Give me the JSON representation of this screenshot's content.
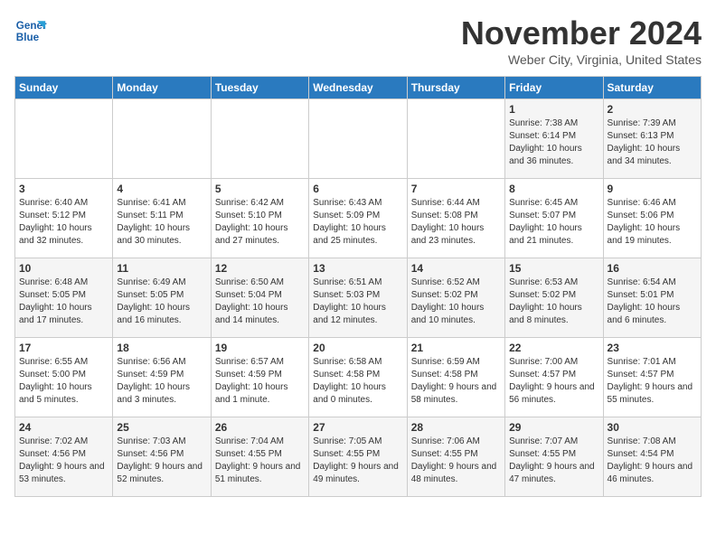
{
  "logo": {
    "line1": "General",
    "line2": "Blue"
  },
  "title": "November 2024",
  "subtitle": "Weber City, Virginia, United States",
  "days_of_week": [
    "Sunday",
    "Monday",
    "Tuesday",
    "Wednesday",
    "Thursday",
    "Friday",
    "Saturday"
  ],
  "weeks": [
    [
      {
        "day": "",
        "info": ""
      },
      {
        "day": "",
        "info": ""
      },
      {
        "day": "",
        "info": ""
      },
      {
        "day": "",
        "info": ""
      },
      {
        "day": "",
        "info": ""
      },
      {
        "day": "1",
        "info": "Sunrise: 7:38 AM\nSunset: 6:14 PM\nDaylight: 10 hours and 36 minutes."
      },
      {
        "day": "2",
        "info": "Sunrise: 7:39 AM\nSunset: 6:13 PM\nDaylight: 10 hours and 34 minutes."
      }
    ],
    [
      {
        "day": "3",
        "info": "Sunrise: 6:40 AM\nSunset: 5:12 PM\nDaylight: 10 hours and 32 minutes."
      },
      {
        "day": "4",
        "info": "Sunrise: 6:41 AM\nSunset: 5:11 PM\nDaylight: 10 hours and 30 minutes."
      },
      {
        "day": "5",
        "info": "Sunrise: 6:42 AM\nSunset: 5:10 PM\nDaylight: 10 hours and 27 minutes."
      },
      {
        "day": "6",
        "info": "Sunrise: 6:43 AM\nSunset: 5:09 PM\nDaylight: 10 hours and 25 minutes."
      },
      {
        "day": "7",
        "info": "Sunrise: 6:44 AM\nSunset: 5:08 PM\nDaylight: 10 hours and 23 minutes."
      },
      {
        "day": "8",
        "info": "Sunrise: 6:45 AM\nSunset: 5:07 PM\nDaylight: 10 hours and 21 minutes."
      },
      {
        "day": "9",
        "info": "Sunrise: 6:46 AM\nSunset: 5:06 PM\nDaylight: 10 hours and 19 minutes."
      }
    ],
    [
      {
        "day": "10",
        "info": "Sunrise: 6:48 AM\nSunset: 5:05 PM\nDaylight: 10 hours and 17 minutes."
      },
      {
        "day": "11",
        "info": "Sunrise: 6:49 AM\nSunset: 5:05 PM\nDaylight: 10 hours and 16 minutes."
      },
      {
        "day": "12",
        "info": "Sunrise: 6:50 AM\nSunset: 5:04 PM\nDaylight: 10 hours and 14 minutes."
      },
      {
        "day": "13",
        "info": "Sunrise: 6:51 AM\nSunset: 5:03 PM\nDaylight: 10 hours and 12 minutes."
      },
      {
        "day": "14",
        "info": "Sunrise: 6:52 AM\nSunset: 5:02 PM\nDaylight: 10 hours and 10 minutes."
      },
      {
        "day": "15",
        "info": "Sunrise: 6:53 AM\nSunset: 5:02 PM\nDaylight: 10 hours and 8 minutes."
      },
      {
        "day": "16",
        "info": "Sunrise: 6:54 AM\nSunset: 5:01 PM\nDaylight: 10 hours and 6 minutes."
      }
    ],
    [
      {
        "day": "17",
        "info": "Sunrise: 6:55 AM\nSunset: 5:00 PM\nDaylight: 10 hours and 5 minutes."
      },
      {
        "day": "18",
        "info": "Sunrise: 6:56 AM\nSunset: 4:59 PM\nDaylight: 10 hours and 3 minutes."
      },
      {
        "day": "19",
        "info": "Sunrise: 6:57 AM\nSunset: 4:59 PM\nDaylight: 10 hours and 1 minute."
      },
      {
        "day": "20",
        "info": "Sunrise: 6:58 AM\nSunset: 4:58 PM\nDaylight: 10 hours and 0 minutes."
      },
      {
        "day": "21",
        "info": "Sunrise: 6:59 AM\nSunset: 4:58 PM\nDaylight: 9 hours and 58 minutes."
      },
      {
        "day": "22",
        "info": "Sunrise: 7:00 AM\nSunset: 4:57 PM\nDaylight: 9 hours and 56 minutes."
      },
      {
        "day": "23",
        "info": "Sunrise: 7:01 AM\nSunset: 4:57 PM\nDaylight: 9 hours and 55 minutes."
      }
    ],
    [
      {
        "day": "24",
        "info": "Sunrise: 7:02 AM\nSunset: 4:56 PM\nDaylight: 9 hours and 53 minutes."
      },
      {
        "day": "25",
        "info": "Sunrise: 7:03 AM\nSunset: 4:56 PM\nDaylight: 9 hours and 52 minutes."
      },
      {
        "day": "26",
        "info": "Sunrise: 7:04 AM\nSunset: 4:55 PM\nDaylight: 9 hours and 51 minutes."
      },
      {
        "day": "27",
        "info": "Sunrise: 7:05 AM\nSunset: 4:55 PM\nDaylight: 9 hours and 49 minutes."
      },
      {
        "day": "28",
        "info": "Sunrise: 7:06 AM\nSunset: 4:55 PM\nDaylight: 9 hours and 48 minutes."
      },
      {
        "day": "29",
        "info": "Sunrise: 7:07 AM\nSunset: 4:55 PM\nDaylight: 9 hours and 47 minutes."
      },
      {
        "day": "30",
        "info": "Sunrise: 7:08 AM\nSunset: 4:54 PM\nDaylight: 9 hours and 46 minutes."
      }
    ]
  ]
}
